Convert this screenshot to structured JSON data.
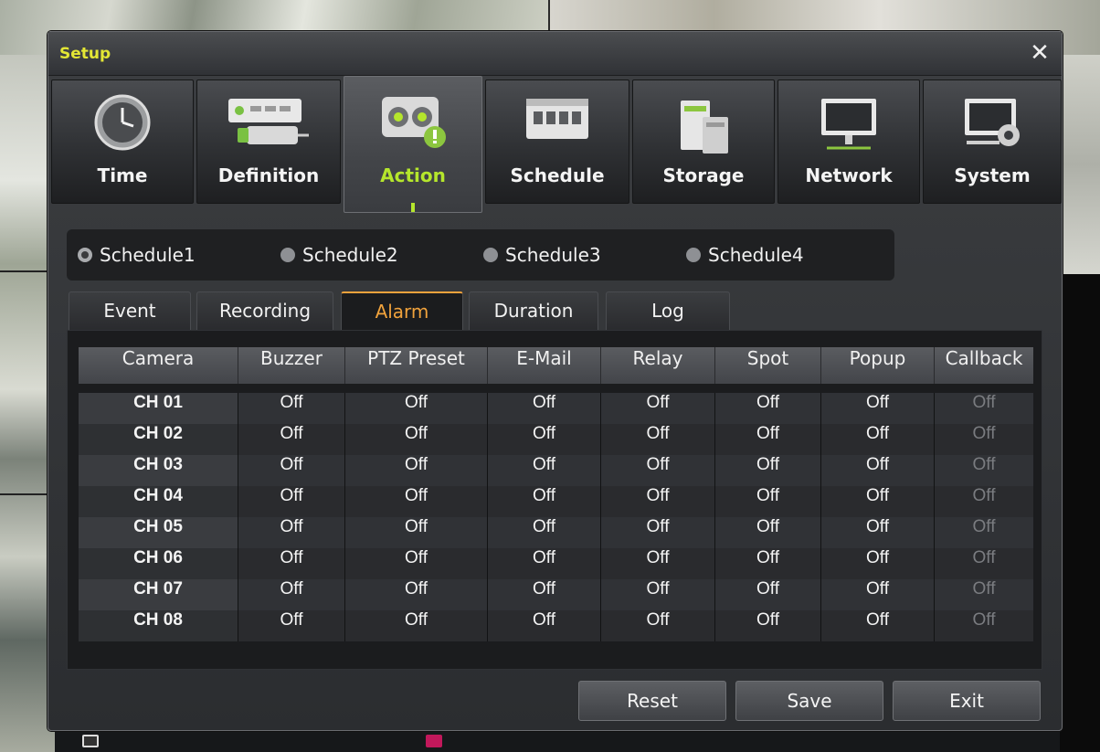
{
  "dialog": {
    "title": "Setup",
    "close_glyph": "✕"
  },
  "menu_tabs": [
    {
      "label": "Time",
      "icon": "clock-icon"
    },
    {
      "label": "Definition",
      "icon": "camera-definition-icon"
    },
    {
      "label": "Action",
      "icon": "action-alert-icon",
      "active": true
    },
    {
      "label": "Schedule",
      "icon": "calendar-icon"
    },
    {
      "label": "Storage",
      "icon": "storage-icon"
    },
    {
      "label": "Network",
      "icon": "monitor-network-icon"
    },
    {
      "label": "System",
      "icon": "system-gear-icon"
    }
  ],
  "schedules": [
    {
      "label": "Schedule1",
      "selected": true
    },
    {
      "label": "Schedule2",
      "selected": false
    },
    {
      "label": "Schedule3",
      "selected": false
    },
    {
      "label": "Schedule4",
      "selected": false
    }
  ],
  "sub_tabs": [
    {
      "label": "Event"
    },
    {
      "label": "Recording"
    },
    {
      "label": "Alarm",
      "active": true
    },
    {
      "label": "Duration"
    },
    {
      "label": "Log"
    }
  ],
  "table": {
    "columns": [
      "Camera",
      "Buzzer",
      "PTZ Preset",
      "E-Mail",
      "Relay",
      "Spot",
      "Popup",
      "Callback"
    ],
    "rows": [
      [
        "CH 01",
        "Off",
        "Off",
        "Off",
        "Off",
        "Off",
        "Off",
        "Off"
      ],
      [
        "CH 02",
        "Off",
        "Off",
        "Off",
        "Off",
        "Off",
        "Off",
        "Off"
      ],
      [
        "CH 03",
        "Off",
        "Off",
        "Off",
        "Off",
        "Off",
        "Off",
        "Off"
      ],
      [
        "CH 04",
        "Off",
        "Off",
        "Off",
        "Off",
        "Off",
        "Off",
        "Off"
      ],
      [
        "CH 05",
        "Off",
        "Off",
        "Off",
        "Off",
        "Off",
        "Off",
        "Off"
      ],
      [
        "CH 06",
        "Off",
        "Off",
        "Off",
        "Off",
        "Off",
        "Off",
        "Off"
      ],
      [
        "CH 07",
        "Off",
        "Off",
        "Off",
        "Off",
        "Off",
        "Off",
        "Off"
      ],
      [
        "CH 08",
        "Off",
        "Off",
        "Off",
        "Off",
        "Off",
        "Off",
        "Off"
      ]
    ]
  },
  "buttons": {
    "reset": "Reset",
    "save": "Save",
    "exit": "Exit"
  },
  "colors": {
    "title": "#e3e635",
    "active_tab": "#b5e62c",
    "active_subtab": "#f0a23c"
  }
}
